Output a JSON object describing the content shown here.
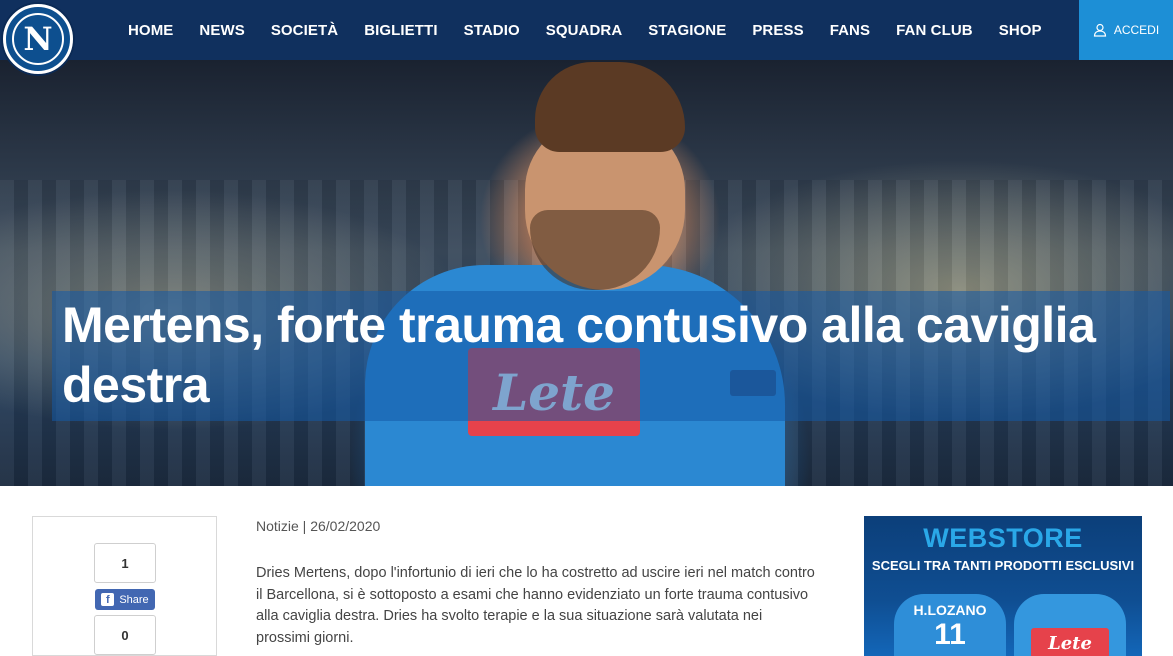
{
  "brand": {
    "logo_letter": "N"
  },
  "nav": {
    "items": [
      "HOME",
      "NEWS",
      "SOCIETÀ",
      "BIGLIETTI",
      "STADIO",
      "SQUADRA",
      "STAGIONE",
      "PRESS",
      "FANS",
      "FAN CLUB",
      "SHOP"
    ]
  },
  "login": {
    "label": "ACCEDI",
    "icon": "user-icon"
  },
  "hero": {
    "title": "Mertens, forte trauma contusivo alla caviglia destra",
    "shirt_sponsor": "Lete"
  },
  "share": {
    "count_top": "1",
    "facebook_label": "Share",
    "facebook_icon": "facebook-icon",
    "count_bottom": "0"
  },
  "article": {
    "category": "Notizie",
    "date": "26/02/2020",
    "body": "Dries Mertens, dopo l'infortunio di ieri che lo ha costretto ad uscire ieri nel match contro il Barcellona, si è sottoposto a esami che hanno evidenziato un forte trauma contusivo alla caviglia destra. Dries ha svolto terapie e la sua situazione sarà valutata nei prossimi giorni."
  },
  "ad": {
    "title": "WEBSTORE",
    "subtitle": "SCEGLI TRA TANTI PRODOTTI ESCLUSIVI",
    "shirt_name": "H.LOZANO",
    "shirt_number": "11",
    "shirt_sponsor": "Lete"
  },
  "colors": {
    "topbar": "#10305e",
    "login": "#1d8fd6",
    "facebook": "#4267b2",
    "webstore": "#2aa8e8"
  }
}
